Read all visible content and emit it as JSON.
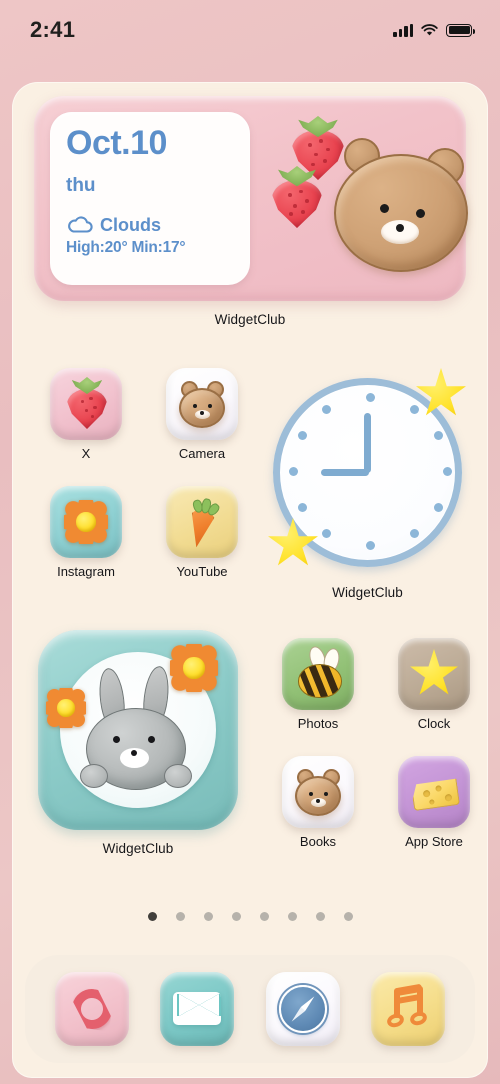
{
  "status_bar": {
    "time": "2:41",
    "signal_icon": "cellular-signal-icon",
    "wifi_icon": "wifi-icon",
    "battery_icon": "battery-full-icon"
  },
  "weather_widget": {
    "label": "WidgetClub",
    "date": "Oct.10",
    "weekday": "thu",
    "condition": "Clouds",
    "condition_icon": "cloud-icon",
    "temps": "High:20° Min:17°",
    "accent_color": "#5c8fca",
    "background_color": "#f2c2c9",
    "decorations": [
      "strawberry",
      "strawberry",
      "bear-face"
    ]
  },
  "clock_widget": {
    "label": "WidgetClub",
    "hour": 9,
    "minute": 0,
    "face_color": "#ffffff",
    "ring_color": "#9dbdd8",
    "decorations": [
      "star",
      "star"
    ]
  },
  "bunny_widget": {
    "label": "WidgetClub",
    "background_color": "#8ccbc8",
    "decorations": [
      "flower",
      "flower",
      "bunny"
    ]
  },
  "apps": [
    {
      "name": "X",
      "icon": "strawberry-icon",
      "bg": "#f2c3cf"
    },
    {
      "name": "Camera",
      "icon": "bear-icon",
      "bg": "#fbfaff"
    },
    {
      "name": "Instagram",
      "icon": "flower-icon",
      "bg": "#8fd2d4"
    },
    {
      "name": "YouTube",
      "icon": "carrot-icon",
      "bg": "#f3de9b"
    },
    {
      "name": "Photos",
      "icon": "bee-icon",
      "bg": "#93c177"
    },
    {
      "name": "Clock",
      "icon": "star-icon",
      "bg": "#bdab97"
    },
    {
      "name": "Books",
      "icon": "bear-icon",
      "bg": "#fbfaff"
    },
    {
      "name": "App Store",
      "icon": "cheese-icon",
      "bg": "#c495d6"
    }
  ],
  "page_indicator": {
    "total": 8,
    "active_index": 0
  },
  "dock": [
    {
      "name": "Phone",
      "icon": "phone-handset-icon",
      "bg": "#f3c2cb"
    },
    {
      "name": "Mail",
      "icon": "envelope-icon",
      "bg": "#7dc9c6"
    },
    {
      "name": "Safari",
      "icon": "compass-icon",
      "bg": "#fbfaff"
    },
    {
      "name": "Music",
      "icon": "music-note-icon",
      "bg": "#f6dd8c"
    }
  ]
}
